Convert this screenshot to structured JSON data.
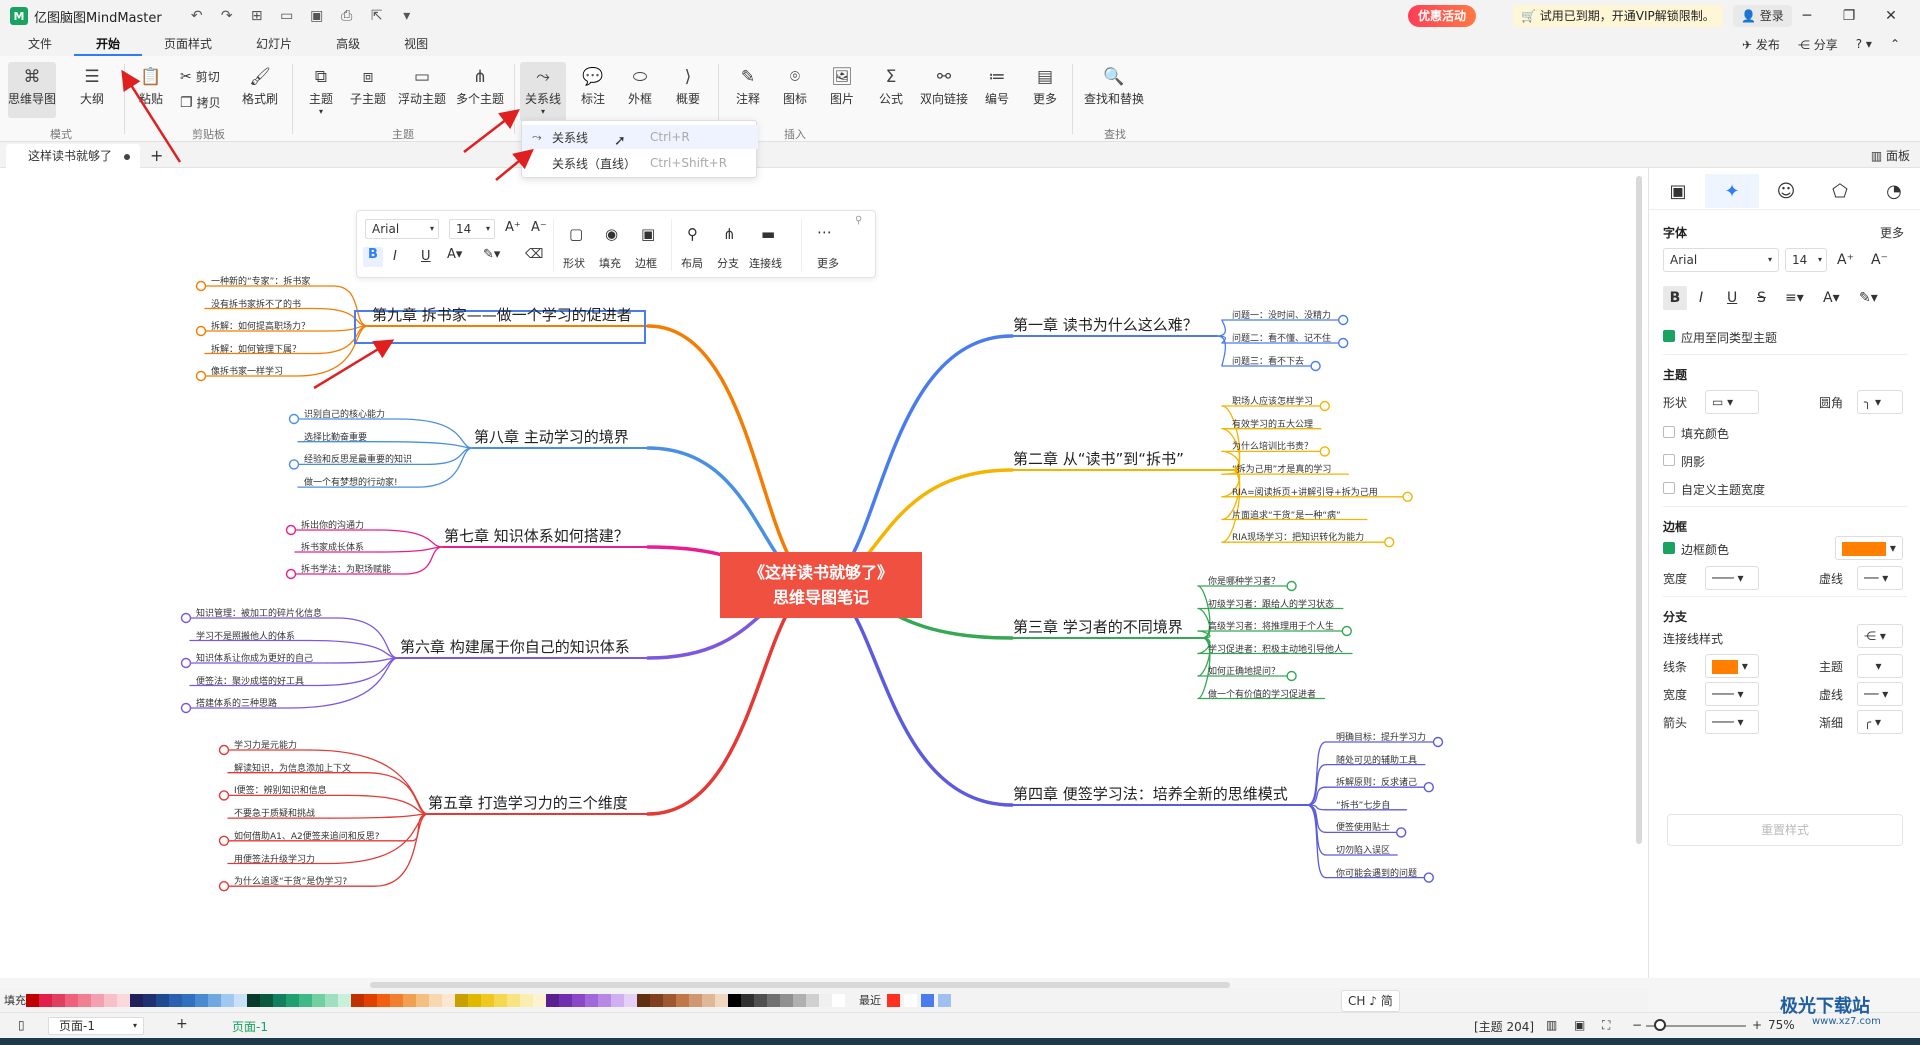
{
  "app": {
    "title": "亿图脑图MindMaster",
    "promo": "优惠活动",
    "vip_notice": "试用已到期，开通VIP解锁限制。",
    "login": "登录"
  },
  "menu": {
    "tabs": [
      "文件",
      "开始",
      "页面样式",
      "幻灯片",
      "高级",
      "视图"
    ],
    "right": [
      "发布",
      "分享",
      "?"
    ]
  },
  "ribbon": {
    "mode": [
      "思维导图",
      "大纲"
    ],
    "clipboard": [
      "粘贴",
      "剪切",
      "拷贝",
      "格式刷"
    ],
    "topic": [
      "主题",
      "子主题",
      "浮动主题",
      "多个主题"
    ],
    "insert": [
      "关系线",
      "标注",
      "外框",
      "概要",
      "注释",
      "图标",
      "图片",
      "公式",
      "双向链接",
      "编号",
      "更多"
    ],
    "find": "查找和替换",
    "groups": [
      "模式",
      "剪贴板",
      "主题",
      "插入",
      "查找"
    ]
  },
  "dropdown": {
    "items": [
      {
        "label": "关系线",
        "shortcut": "Ctrl+R"
      },
      {
        "label": "关系线（直线）",
        "shortcut": "Ctrl+Shift+R"
      }
    ]
  },
  "doc": {
    "tab": "这样读书就够了",
    "panel_toggle": "面板"
  },
  "float_toolbar": {
    "font": "Arial",
    "size": "14",
    "labels": [
      "形状",
      "填充",
      "边框",
      "布局",
      "分支",
      "连接线",
      "更多"
    ]
  },
  "mindmap": {
    "central": [
      "《这样读书就够了》",
      "思维导图笔记"
    ],
    "right": [
      {
        "title": "第一章 读书为什么这么难？",
        "color": "#4a7cf0",
        "leaves": [
          "问题一：没时间、没精力",
          "问题二：看不懂、记不住",
          "问题三：看不下去"
        ]
      },
      {
        "title": "第二章 从“读书”到“拆书”",
        "color": "#f4b400",
        "leaves": [
          "职场人应该怎样学习",
          "有效学习的五大公理",
          "为什么培训比书贵？",
          "“拆为己用”才是真的学习",
          "RIA=阅读拆页+讲解引导+拆为己用",
          "片面追求“干货”是一种“病”",
          "RIA现场学习：把知识转化为能力"
        ]
      },
      {
        "title": "第三章 学习者的不同境界",
        "color": "#34a853",
        "leaves": [
          "你是哪种学习者？",
          "初级学习者：跟给人的学习状态",
          "高级学习者：将推理用于个人生",
          "学习促进者：积极主动地引导他人",
          "如何正确地提问？",
          "做一个有价值的学习促进者"
        ]
      },
      {
        "title": "第四章 便签学习法：培养全新的思维模式",
        "color": "#5b5be0",
        "leaves": [
          "明确目标：提升学习力",
          "随处可见的辅助工具",
          "拆解原则：反求诸己",
          "“拆书”七步自",
          "便签使用贴士",
          "切勿陷入误区",
          "你可能会遇到的问题"
        ]
      }
    ],
    "left": [
      {
        "title": "第九章 拆书家——做一个学习的促进者",
        "color": "#f57c00",
        "leaves": [
          "一种新的“专家”：拆书家",
          "没有拆书家拆不了的书",
          "拆解：如何提高职场力？",
          "拆解：如何管理下属？",
          "像拆书家一样学习"
        ]
      },
      {
        "title": "第八章 主动学习的境界",
        "color": "#4a90e2",
        "leaves": [
          "识别自己的核心能力",
          "选择比勤奋重要",
          "经验和反思是最重要的知识",
          "做一个有梦想的行动家!"
        ]
      },
      {
        "title": "第七章 知识体系如何搭建？",
        "color": "#e91e8c",
        "leaves": [
          "拆出你的沟通力",
          "拆书家成长体系",
          "拆书学法：为职场赋能"
        ]
      },
      {
        "title": "第六章 构建属于你自己的知识体系",
        "color": "#7e57e0",
        "leaves": [
          "知识管理：被加工的碎片化信息",
          "学习不是照搬他人的体系",
          "知识体系让你成为更好的自己",
          "便签法：聚沙成塔的好工具",
          "搭建体系的三种思路"
        ]
      },
      {
        "title": "第五章 打造学习力的三个维度",
        "color": "#e53935",
        "leaves": [
          "学习力是元能力",
          "解读知识，为信息添加上下文",
          "I便签：辨别知识和信息",
          "不要急于质疑和挑战",
          "如何借助A1、A2便签来追问和反思?",
          "用便签法升级学习力",
          "为什么追逐“干货”是伪学习?"
        ]
      }
    ]
  },
  "right_panel": {
    "font_section": "字体",
    "more": "更多",
    "font": "Arial",
    "size": "14",
    "apply_same": "应用至同类型主题",
    "topic_section": "主题",
    "shape": "形状",
    "corner": "圆角",
    "fill_color": "填充颜色",
    "shadow": "阴影",
    "custom_width": "自定义主题宽度",
    "border_section": "边框",
    "border_color": "边框颜色",
    "border_color_value": "#ff7f00",
    "width": "宽度",
    "dash": "虚线",
    "branch_section": "分支",
    "connector_style": "连接线样式",
    "line": "线条",
    "line_color_value": "#ff7f00",
    "topic": "主题",
    "arrow": "箭头",
    "taper": "渐细",
    "reset": "重置样式"
  },
  "palette": {
    "label": "填充",
    "recent": "最近",
    "ime": "CH ♪ 简"
  },
  "status": {
    "page_select": "页面-1",
    "page_tab": "页面-1",
    "topic_count": "[主题 204]",
    "zoom": "75%"
  },
  "watermark": {
    "text": "极光下载站",
    "sub": "www.xz7.com"
  }
}
